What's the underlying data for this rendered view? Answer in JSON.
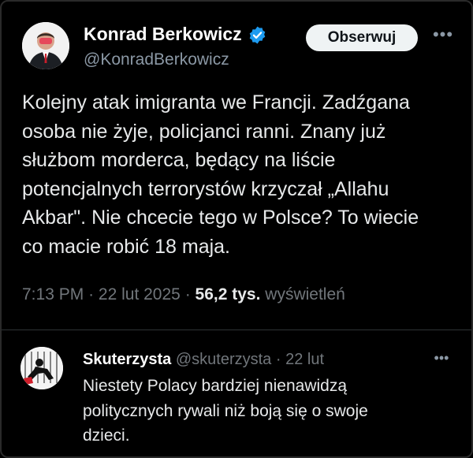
{
  "colors": {
    "background": "#000000",
    "text_primary": "#e7e9ea",
    "text_secondary": "#71767b",
    "verified_badge": "#1d9bf0",
    "follow_button_bg": "#eff3f4",
    "divider": "#2f3336"
  },
  "main_tweet": {
    "author": {
      "display_name": "Konrad Berkowicz",
      "handle": "@KonradBerkowicz",
      "verified": true,
      "avatar_icon": "profile-photo"
    },
    "follow_label": "Obserwuj",
    "more_icon": "more-options-icon",
    "text_lines": [
      "Kolejny atak imigranta we Francji. Zadźgana",
      "osoba nie żyje, policjanci ranni. Znany już",
      "służbom morderca, będący na liście",
      "potencjalnych terrorystów krzyczał „Allahu",
      "Akbar\". Nie chcecie tego w Polsce? To wiecie",
      "co macie robić 18 maja."
    ],
    "time": "7:13 PM",
    "separator": "·",
    "date": "22 lut 2025",
    "views_count": "56,2 tys.",
    "views_label": "wyświetleń"
  },
  "reply": {
    "author": {
      "display_name": "Skuterzysta",
      "handle": "@skuterzysta",
      "avatar_icon": "profile-photo"
    },
    "separator": "·",
    "date": "22 lut",
    "more_icon": "more-options-icon",
    "text_lines": [
      "Niestety Polacy bardziej nienawidzą",
      "politycznych rywali niż boją się o swoje",
      "dzieci."
    ]
  }
}
